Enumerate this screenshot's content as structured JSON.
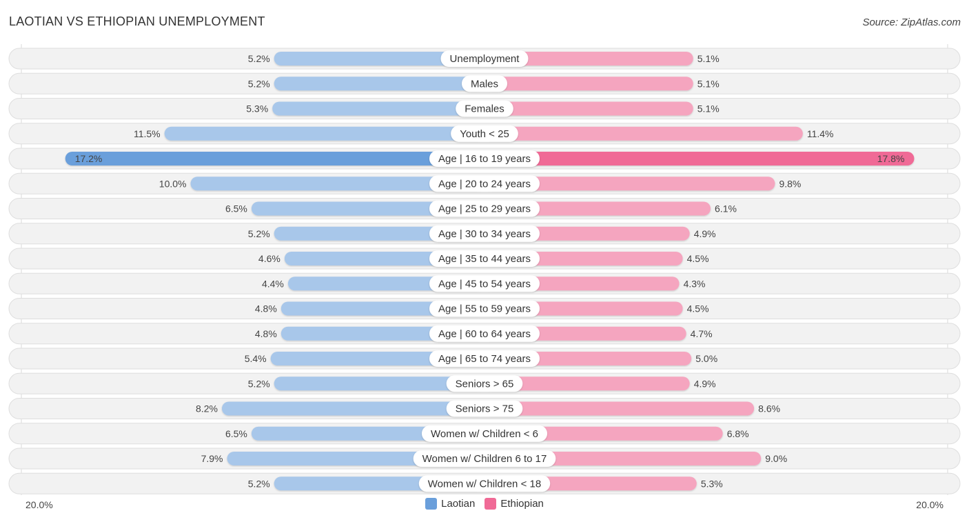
{
  "header": {
    "title": "LAOTIAN VS ETHIOPIAN UNEMPLOYMENT",
    "source": "Source: ZipAtlas.com"
  },
  "colors": {
    "laotian": "#6a9fdb",
    "laotian_light": "#a8c7ea",
    "ethiopian": "#f06a96",
    "ethiopian_light": "#f5a5bf",
    "track": "#f2f2f2"
  },
  "axis": {
    "left_label": "20.0%",
    "right_label": "20.0%"
  },
  "legend": [
    {
      "label": "Laotian",
      "color": "#6a9fdb"
    },
    {
      "label": "Ethiopian",
      "color": "#f06a96"
    }
  ],
  "chart_data": {
    "type": "bar",
    "orientation": "horizontal-diverging",
    "title": "LAOTIAN VS ETHIOPIAN UNEMPLOYMENT",
    "xlabel": "",
    "ylabel": "",
    "xlim": [
      -20,
      20
    ],
    "unit": "%",
    "legend_position": "bottom-center",
    "categories": [
      "Unemployment",
      "Males",
      "Females",
      "Youth < 25",
      "Age | 16 to 19 years",
      "Age | 20 to 24 years",
      "Age | 25 to 29 years",
      "Age | 30 to 34 years",
      "Age | 35 to 44 years",
      "Age | 45 to 54 years",
      "Age | 55 to 59 years",
      "Age | 60 to 64 years",
      "Age | 65 to 74 years",
      "Seniors > 65",
      "Seniors > 75",
      "Women w/ Children < 6",
      "Women w/ Children 6 to 17",
      "Women w/ Children < 18"
    ],
    "series": [
      {
        "name": "Laotian",
        "side": "left",
        "values": [
          5.2,
          5.2,
          5.3,
          11.5,
          17.2,
          10.0,
          6.5,
          5.2,
          4.6,
          4.4,
          4.8,
          4.8,
          5.4,
          5.2,
          8.2,
          6.5,
          7.9,
          5.2
        ],
        "labels": [
          "5.2%",
          "5.2%",
          "5.3%",
          "11.5%",
          "17.2%",
          "10.0%",
          "6.5%",
          "5.2%",
          "4.6%",
          "4.4%",
          "4.8%",
          "4.8%",
          "5.4%",
          "5.2%",
          "8.2%",
          "6.5%",
          "7.9%",
          "5.2%"
        ]
      },
      {
        "name": "Ethiopian",
        "side": "right",
        "values": [
          5.1,
          5.1,
          5.1,
          11.4,
          17.8,
          9.8,
          6.1,
          4.9,
          4.5,
          4.3,
          4.5,
          4.7,
          5.0,
          4.9,
          8.6,
          6.8,
          9.0,
          5.3
        ],
        "labels": [
          "5.1%",
          "5.1%",
          "5.1%",
          "11.4%",
          "17.8%",
          "9.8%",
          "6.1%",
          "4.9%",
          "4.5%",
          "4.3%",
          "4.5%",
          "4.7%",
          "5.0%",
          "4.9%",
          "8.6%",
          "6.8%",
          "9.0%",
          "5.3%"
        ]
      }
    ],
    "highlight_index": 4
  }
}
